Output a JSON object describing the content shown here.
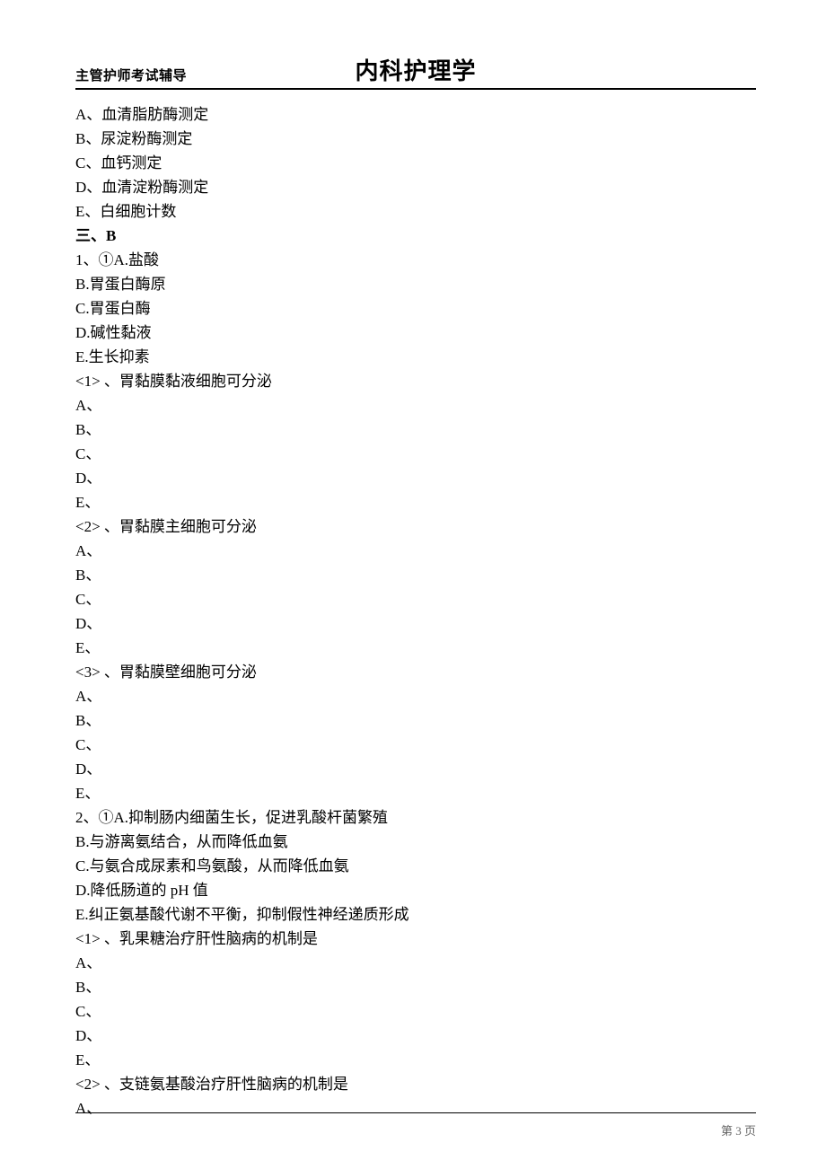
{
  "header": {
    "left": "主管护师考试辅导",
    "center": "内科护理学"
  },
  "lines": [
    "A、血清脂肪酶测定",
    "B、尿淀粉酶测定",
    "C、血钙测定",
    "D、血清淀粉酶测定",
    "E、白细胞计数"
  ],
  "section": "三、B",
  "q1": {
    "lead": "1、①A.盐酸",
    "opts": [
      "B.胃蛋白酶原",
      "C.胃蛋白酶",
      "D.碱性黏液",
      "E.生长抑素"
    ],
    "sub1": "<1> 、胃黏膜黏液细胞可分泌",
    "sub2": "<2> 、胃黏膜主细胞可分泌",
    "sub3": "<3> 、胃黏膜壁细胞可分泌"
  },
  "q2": {
    "lead": "2、①A.抑制肠内细菌生长，促进乳酸杆菌繁殖",
    "opts": [
      "B.与游离氨结合，从而降低血氨",
      "C.与氨合成尿素和鸟氨酸，从而降低血氨",
      "D.降低肠道的 pH 值",
      "E.纠正氨基酸代谢不平衡，抑制假性神经递质形成"
    ],
    "sub1": "<1> 、乳果糖治疗肝性脑病的机制是",
    "sub2": "<2> 、支链氨基酸治疗肝性脑病的机制是"
  },
  "blank": {
    "A": "A、",
    "B": "B、",
    "C": "C、",
    "D": "D、",
    "E": "E、"
  },
  "footer": {
    "page": "第 3 页"
  }
}
